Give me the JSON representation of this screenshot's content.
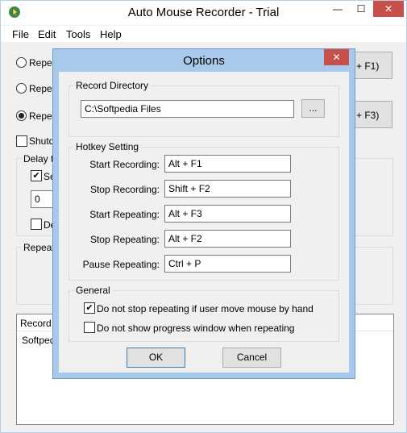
{
  "window": {
    "title": "Auto Mouse Recorder - Trial",
    "buttons": {
      "minimize": "—",
      "maximize": "☐",
      "close": "✕"
    }
  },
  "menu": [
    "File",
    "Edit",
    "Tools",
    "Help"
  ],
  "background": {
    "radio_1": "Repea",
    "radio_2": "Repea",
    "radio_3": "Repea",
    "button_1": "+ F1)",
    "button_3": "+ F3)",
    "shutdown": "Shutdo",
    "delay_group": "Delay ti",
    "delay_check": "Se",
    "delay_value": "0",
    "de_check": "De",
    "repeat_group": "Repeat",
    "list_header": "Record N",
    "list_item": "Softpedia"
  },
  "dialog": {
    "title": "Options",
    "close": "✕",
    "record_directory": {
      "legend": "Record Directory",
      "path": "C:\\Softpedia Files",
      "browse": "..."
    },
    "hotkey": {
      "legend": "Hotkey Setting",
      "rows": [
        {
          "label": "Start Recording:",
          "value": "Alt + F1"
        },
        {
          "label": "Stop Recording:",
          "value": "Shift + F2"
        },
        {
          "label": "Start Repeating:",
          "value": "Alt + F3"
        },
        {
          "label": "Stop Repeating:",
          "value": "Alt + F2"
        },
        {
          "label": "Pause Repeating:",
          "value": "Ctrl + P"
        }
      ]
    },
    "general": {
      "legend": "General",
      "option_1": "Do not stop repeating if user move mouse by hand",
      "option_1_checked": true,
      "option_2": "Do not show progress window when repeating",
      "option_2_checked": false
    },
    "ok": "OK",
    "cancel": "Cancel"
  }
}
